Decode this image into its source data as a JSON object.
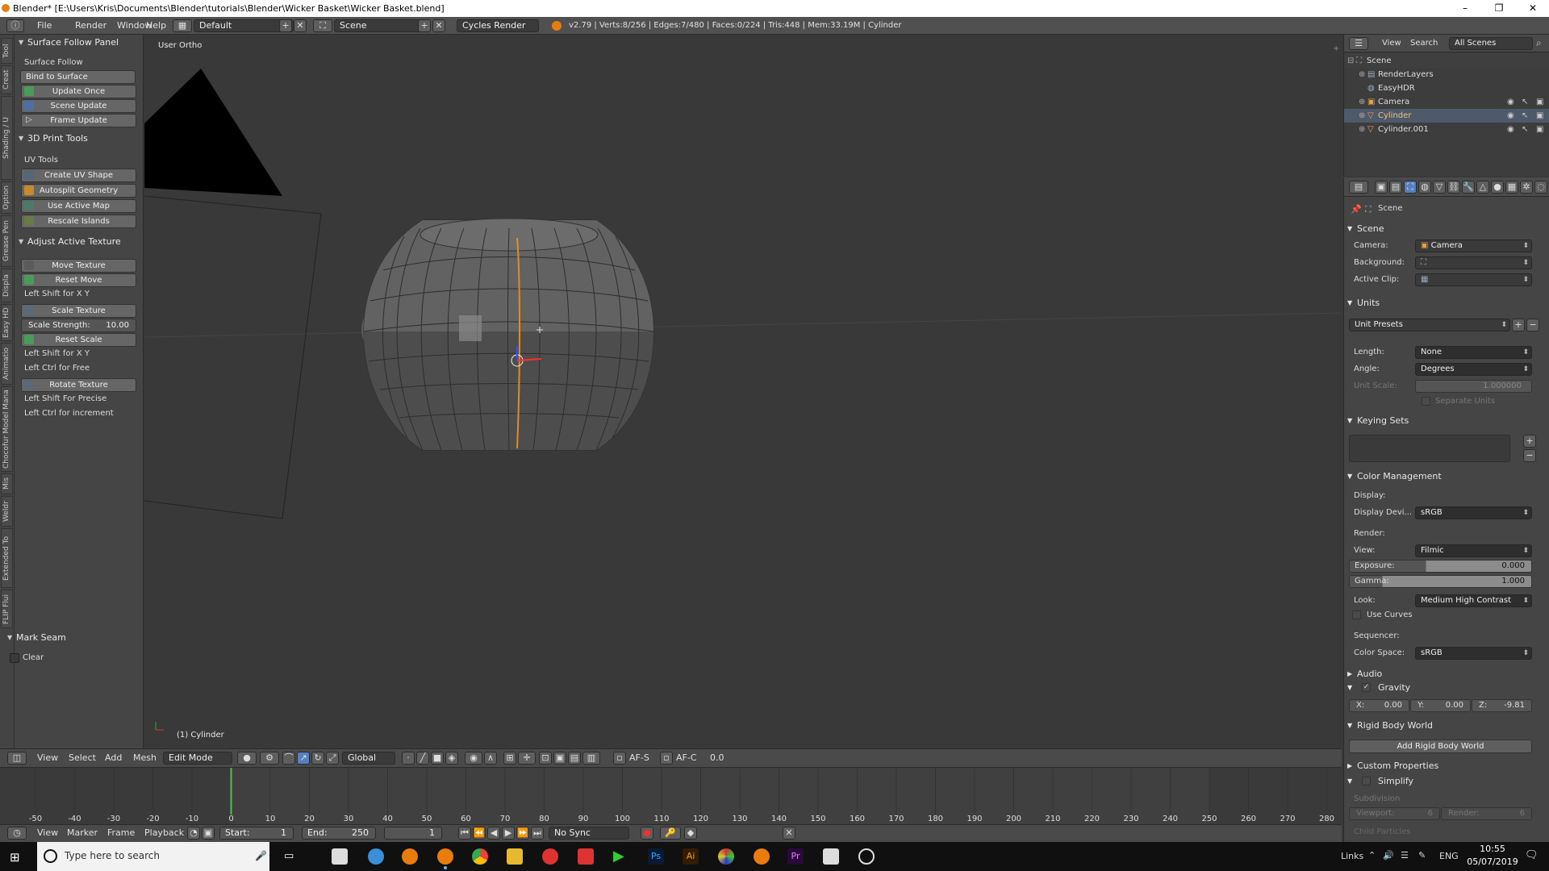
{
  "window": {
    "title": "Blender* [E:\\Users\\Kris\\Documents\\Blender\\tutorials\\Blender\\Wicker Basket\\Wicker Basket.blend]",
    "minimize": "–",
    "maximize": "❐",
    "close": "✕"
  },
  "menubar": {
    "items": [
      "File",
      "Render",
      "Window",
      "Help"
    ],
    "layout": "Default",
    "scene": "Scene",
    "engine": "Cycles Render",
    "stats": "v2.79 | Verts:8/256 | Edges:7/480 | Faces:0/224 | Tris:448 | Mem:33.19M | Cylinder"
  },
  "tabs": [
    "Tool",
    "Creat",
    "Shading / U",
    "Option",
    "Grease Pen",
    "Displa",
    "Easy HD",
    "Animatio",
    "Chocofur Model Mana",
    "Mis",
    "Weldr",
    "Extended To",
    "FLIP Flui"
  ],
  "left_panel": {
    "surface_follow": {
      "header": "Surface Follow Panel",
      "label": "Surface Follow",
      "bind": "Bind to Surface",
      "update_once": "Update Once",
      "scene_update": "Scene Update",
      "frame_update": "Frame Update"
    },
    "print3d": {
      "header": "3D Print Tools",
      "label": "UV Tools",
      "create_uv": "Create UV Shape",
      "autosplit": "Autosplit Geometry",
      "use_active": "Use Active Map",
      "rescale": "Rescale Islands"
    },
    "adjust": {
      "header": "Adjust Active Texture",
      "move": "Move Texture",
      "reset_move": "Reset Move",
      "hint1": "Left Shift for X Y",
      "scale": "Scale Texture",
      "strength_label": "Scale Strength:",
      "strength_value": "10.00",
      "reset_scale": "Reset Scale",
      "hint2": "Left Shift for X Y",
      "hint3": "Left Ctrl for Free",
      "rotate": "Rotate Texture",
      "hint4": "Left Shift For Precise",
      "hint5": "Left Ctrl for increment"
    },
    "mark_seam": {
      "header": "Mark Seam",
      "clear": "Clear"
    }
  },
  "viewport": {
    "view_name": "User Ortho",
    "object_label": "(1) Cylinder"
  },
  "view_header": {
    "view": "View",
    "select": "Select",
    "add": "Add",
    "mesh": "Mesh",
    "mode": "Edit Mode",
    "orientation": "Global",
    "afs": "AF-S",
    "afc": "AF-C",
    "value": "0.0"
  },
  "timeline": {
    "ticks": [
      "-50",
      "-40",
      "-30",
      "-20",
      "-10",
      "0",
      "10",
      "20",
      "30",
      "40",
      "50",
      "60",
      "70",
      "80",
      "90",
      "100",
      "110",
      "120",
      "130",
      "140",
      "150",
      "160",
      "170",
      "180",
      "190",
      "200",
      "210",
      "220",
      "230",
      "240",
      "250",
      "260",
      "270",
      "280"
    ],
    "current_frame": 0
  },
  "timeline_header": {
    "view": "View",
    "marker": "Marker",
    "frame": "Frame",
    "playback": "Playback",
    "start_label": "Start:",
    "start": "1",
    "end_label": "End:",
    "end": "250",
    "current": "1",
    "sync": "No Sync"
  },
  "outliner": {
    "view": "View",
    "search": "Search",
    "filter": "All Scenes",
    "items": [
      "Scene",
      "RenderLayers",
      "EasyHDR",
      "Camera",
      "Cylinder",
      "Cylinder.001"
    ]
  },
  "properties": {
    "context": "Scene",
    "scene": {
      "header": "Scene",
      "camera_label": "Camera:",
      "camera": "Camera",
      "background_label": "Background:",
      "active_clip_label": "Active Clip:"
    },
    "units": {
      "header": "Units",
      "presets": "Unit Presets",
      "length_label": "Length:",
      "length": "None",
      "angle_label": "Angle:",
      "angle": "Degrees",
      "scale_label": "Unit Scale:",
      "scale": "1.000000",
      "separate": "Separate Units"
    },
    "keying": {
      "header": "Keying Sets"
    },
    "color": {
      "header": "Color Management",
      "display_label": "Display:",
      "device_label": "Display Devi...",
      "device": "sRGB",
      "render_label": "Render:",
      "view_label": "View:",
      "view": "Filmic",
      "exposure_label": "Exposure:",
      "exposure": "0.000",
      "gamma_label": "Gamma:",
      "gamma": "1.000",
      "look_label": "Look:",
      "look": "Medium High Contrast",
      "use_curves": "Use Curves",
      "sequencer_label": "Sequencer:",
      "space_label": "Color Space:",
      "space": "sRGB"
    },
    "audio": "Audio",
    "gravity": {
      "header": "Gravity",
      "x_label": "X:",
      "x": "0.00",
      "y_label": "Y:",
      "y": "0.00",
      "z_label": "Z:",
      "z": "-9.81"
    },
    "rigid": {
      "header": "Rigid Body World",
      "add": "Add Rigid Body World"
    },
    "custom": "Custom Properties",
    "simplify": {
      "header": "Simplify",
      "subdivision": "Subdivision",
      "viewport_label": "Viewport:",
      "viewport": "6",
      "render_label": "Render:",
      "render": "6",
      "child": "Child Particles"
    }
  },
  "taskbar": {
    "search": "Type here to search",
    "links": "Links",
    "lang": "ENG",
    "time": "10:55",
    "date": "05/07/2019"
  },
  "colors": {
    "accent_blue": "#5680c2",
    "active_orange": "#f0a040",
    "frame_green": "#50c050"
  }
}
